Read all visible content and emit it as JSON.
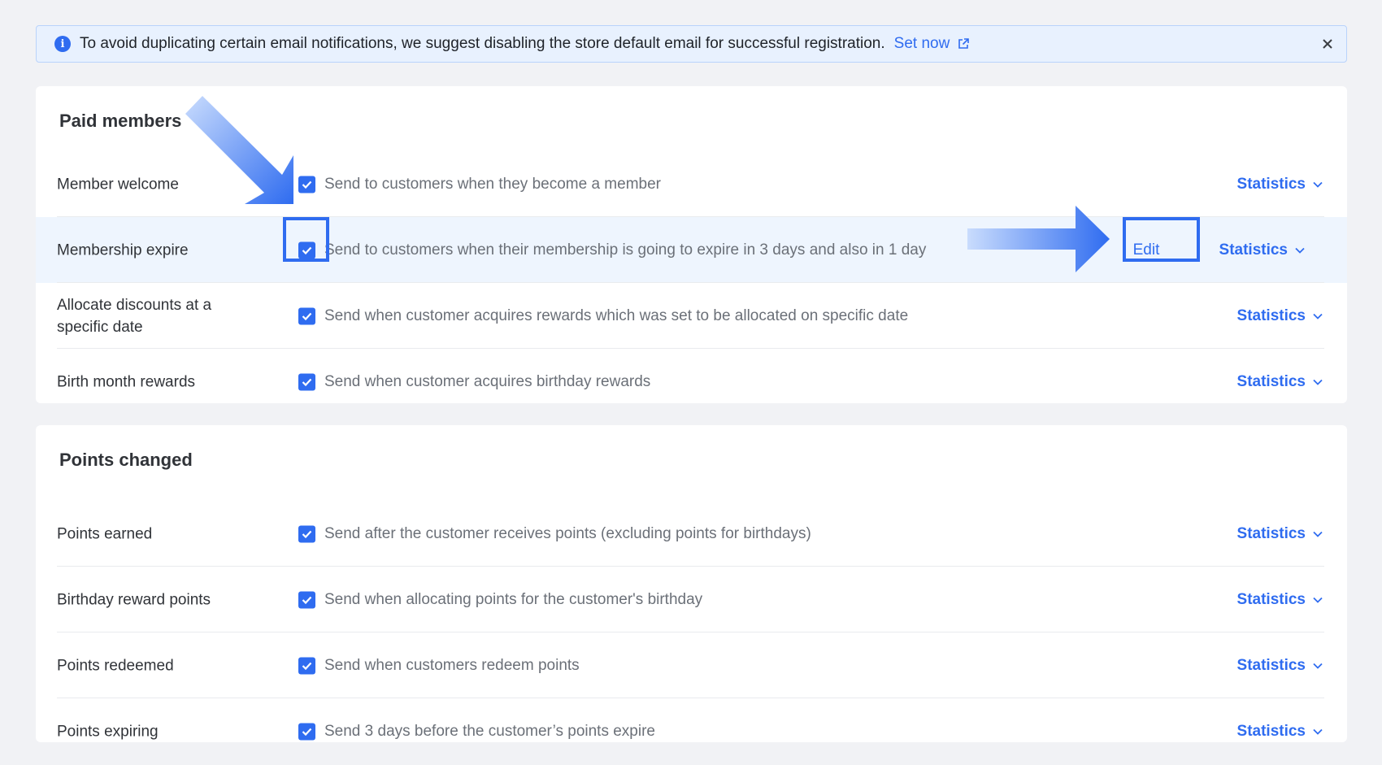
{
  "banner": {
    "icon": "info-icon",
    "text": "To avoid duplicating certain email notifications, we suggest disabling the store default email for successful registration.",
    "link_label": "Set now",
    "link_icon": "external-link-icon",
    "close_icon": "close-icon"
  },
  "sections": [
    {
      "title": "Paid members",
      "rows": [
        {
          "label": "Member welcome",
          "description": "Send to customers when they become a member",
          "checked": true,
          "stats_label": "Statistics"
        },
        {
          "label": "Membership expire",
          "description": "Send to customers when their membership is going to expire in 3 days and also in 1 day",
          "checked": true,
          "stats_label": "Statistics",
          "edit_label": "Edit",
          "highlighted": true
        },
        {
          "label": "Allocate discounts at a specific date",
          "description": "Send when customer acquires rewards which was set to be allocated on specific date",
          "checked": true,
          "stats_label": "Statistics"
        },
        {
          "label": "Birth month rewards",
          "description": "Send when customer acquires birthday rewards",
          "checked": true,
          "stats_label": "Statistics"
        }
      ]
    },
    {
      "title": "Points changed",
      "rows": [
        {
          "label": "Points earned",
          "description": "Send after the customer receives points (excluding points for birthdays)",
          "checked": true,
          "stats_label": "Statistics"
        },
        {
          "label": "Birthday reward points",
          "description": "Send when allocating points for the customer's birthday",
          "checked": true,
          "stats_label": "Statistics"
        },
        {
          "label": "Points redeemed",
          "description": "Send when customers redeem points",
          "checked": true,
          "stats_label": "Statistics"
        },
        {
          "label": "Points expiring",
          "description": "Send 3 days before the customer’s points expire",
          "checked": true,
          "stats_label": "Statistics"
        }
      ]
    }
  ],
  "colors": {
    "accent": "#2f6cf0",
    "highlight_row": "#eef5fe",
    "banner_bg": "#e8f1fe",
    "page_bg": "#f1f2f5"
  }
}
